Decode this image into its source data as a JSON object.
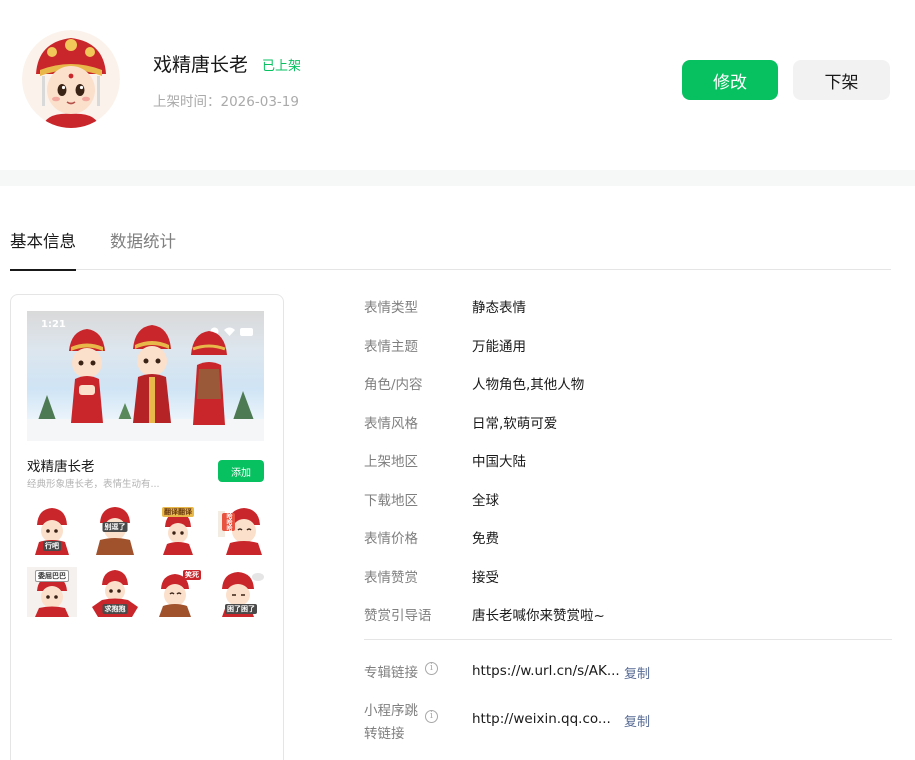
{
  "header": {
    "title": "戏精唐长老",
    "status": "已上架",
    "publish_time": "上架时间：2026-03-19",
    "edit_button": "修改",
    "unlist_button": "下架"
  },
  "tabs": [
    {
      "label": "基本信息",
      "active": true
    },
    {
      "label": "数据统计",
      "active": false
    }
  ],
  "preview": {
    "status_time": "1:21",
    "name": "戏精唐长老",
    "description": "经典形象唐长老，表情生动有...",
    "add_button": "添加",
    "stickers": [
      {
        "caption": "行吧"
      },
      {
        "caption": "别逗了"
      },
      {
        "caption": "翻译翻译"
      },
      {
        "caption": "哈哈哈"
      },
      {
        "caption": "委屈巴巴"
      },
      {
        "caption": "求抱抱"
      },
      {
        "caption": "笑死"
      },
      {
        "caption": "困了困了"
      }
    ]
  },
  "info": [
    {
      "label": "表情类型",
      "value": "静态表情"
    },
    {
      "label": "表情主题",
      "value": "万能通用"
    },
    {
      "label": "角色/内容",
      "value": "人物角色,其他人物"
    },
    {
      "label": "表情风格",
      "value": "日常,软萌可爱"
    },
    {
      "label": "上架地区",
      "value": "中国大陆"
    },
    {
      "label": "下载地区",
      "value": "全球"
    },
    {
      "label": "表情价格",
      "value": "免费"
    },
    {
      "label": "表情赞赏",
      "value": "接受"
    },
    {
      "label": "赞赏引导语",
      "value": "唐长老喊你来赞赏啦~"
    }
  ],
  "links": {
    "album": {
      "label": "专辑链接",
      "value": "https://w.url.cn/s/AK...",
      "copy": "复制"
    },
    "miniprogram": {
      "label_line1": "小程序跳",
      "label_line2": "转链接",
      "value": "http://weixin.qq.co...",
      "copy": "复制"
    }
  },
  "colors": {
    "accent": "#07c160",
    "link": "#576b95",
    "label": "#7f7f7f",
    "text": "#191919"
  }
}
